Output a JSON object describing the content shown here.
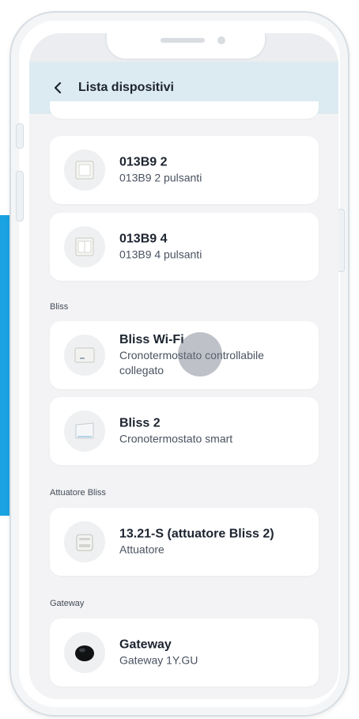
{
  "header": {
    "title": "Lista dispositivi",
    "back_icon": "chevron-left-icon"
  },
  "devices_top": [
    {
      "name": "013B9 2",
      "description": "013B9 2 pulsanti",
      "icon": "switch-2-button-icon"
    },
    {
      "name": "013B9 4",
      "description": "013B9 4 pulsanti",
      "icon": "switch-4-button-icon"
    }
  ],
  "sections": [
    {
      "title": "Bliss",
      "items": [
        {
          "name": "Bliss Wi-Fi",
          "description": "Cronotermostato controllabile collegato",
          "icon": "thermostat-icon"
        },
        {
          "name": "Bliss 2",
          "description": "Cronotermostato smart",
          "icon": "smart-thermostat-icon"
        }
      ]
    },
    {
      "title": "Attuatore Bliss",
      "items": [
        {
          "name": "13.21-S (attuatore Bliss 2)",
          "description": "Attuatore",
          "icon": "actuator-icon"
        }
      ]
    },
    {
      "title": "Gateway",
      "items": [
        {
          "name": "Gateway",
          "description": "Gateway 1Y.GU",
          "icon": "gateway-icon"
        }
      ]
    }
  ],
  "colors": {
    "header_bg": "#dcebf1",
    "screen_bg": "#f3f3f5",
    "accent_blue": "#1aa3e2"
  }
}
